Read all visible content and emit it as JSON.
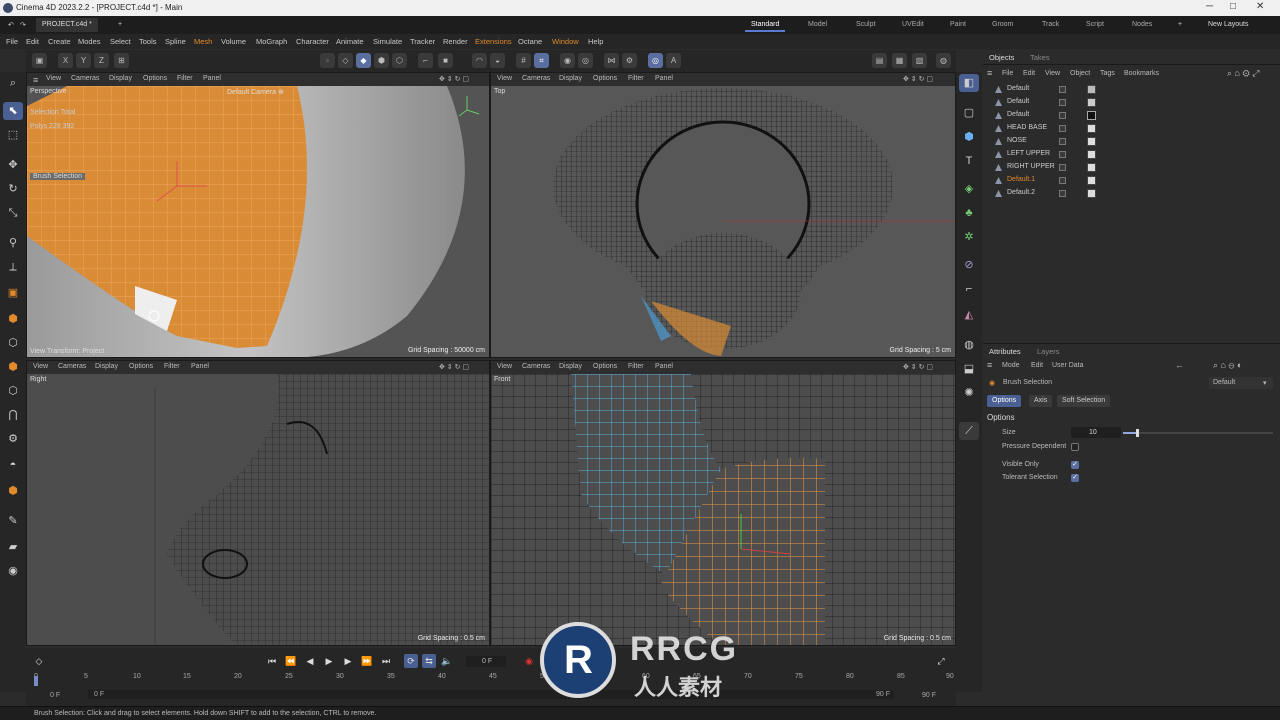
{
  "window": {
    "title": "Cinema 4D 2023.2.2 - [PROJECT.c4d *] - Main",
    "minimize": "─",
    "maximize": "□",
    "close": "✕"
  },
  "doc_tab": "PROJECT.c4d *",
  "layouts": [
    "Standard",
    "Model",
    "Sculpt",
    "UVEdit",
    "Paint",
    "Groom",
    "Track",
    "Script",
    "Nodes"
  ],
  "new_layouts": "New Layouts",
  "menus": [
    "File",
    "Edit",
    "Create",
    "Modes",
    "Select",
    "Tools",
    "Spline",
    "Mesh",
    "Volume",
    "MoGraph",
    "Character",
    "Animate",
    "Simulate",
    "Tracker",
    "Render",
    "Extensions",
    "Octane",
    "Window",
    "Help"
  ],
  "toolbar": {
    "axes": [
      "X",
      "Y",
      "Z"
    ]
  },
  "viewport_menu": [
    "View",
    "Cameras",
    "Display",
    "Options",
    "Filter",
    "Panel"
  ],
  "viewports": {
    "persp": {
      "label": "Perspective",
      "camera": "Default Camera ⊕",
      "grid": "Grid Spacing : 50000 cm",
      "transform": "View Transform: Project",
      "sel_total": "Selection Total",
      "polys": "Polys  228     392",
      "brush": "Brush Selection"
    },
    "top": {
      "label": "Top",
      "grid": "Grid Spacing : 5 cm"
    },
    "right": {
      "label": "Right",
      "grid": "Grid Spacing : 0.5 cm"
    },
    "front": {
      "label": "Front",
      "grid": "Grid Spacing : 0.5 cm"
    }
  },
  "objects": {
    "tabs": [
      "Objects",
      "Takes"
    ],
    "menu": [
      "File",
      "Edit",
      "View",
      "Object",
      "Tags",
      "Bookmarks"
    ],
    "items": [
      "Default",
      "Default",
      "Default",
      "HEAD BASE",
      "NOSE",
      "LEFT UPPER",
      "RIGHT UPPER",
      "Default.1",
      "Default.2"
    ]
  },
  "attributes": {
    "tabs": [
      "Attributes",
      "Layers"
    ],
    "menu": [
      "Mode",
      "Edit",
      "User Data"
    ],
    "tool": "Brush Selection",
    "preset": "Default",
    "subtabs": [
      "Options",
      "Axis",
      "Soft Selection"
    ],
    "section": "Options",
    "size_label": "Size",
    "size_value": "10",
    "pressure": "Pressure Dependent",
    "visible": "Visible Only",
    "tolerant": "Tolerant Selection"
  },
  "timeline": {
    "ticks": [
      "0",
      "5",
      "10",
      "15",
      "20",
      "25",
      "30",
      "35",
      "40",
      "45",
      "50",
      "55",
      "60",
      "65",
      "70",
      "75",
      "80",
      "85",
      "90"
    ],
    "frame": "0 F",
    "start": "0 F",
    "start2": "0 F",
    "end": "90 F",
    "end2": "90 F"
  },
  "status": "Brush Selection: Click and drag to select elements. Hold down SHIFT to add to the selection, CTRL to remove.",
  "watermark": {
    "brand": "RRCG",
    "sub": "人人素材"
  }
}
